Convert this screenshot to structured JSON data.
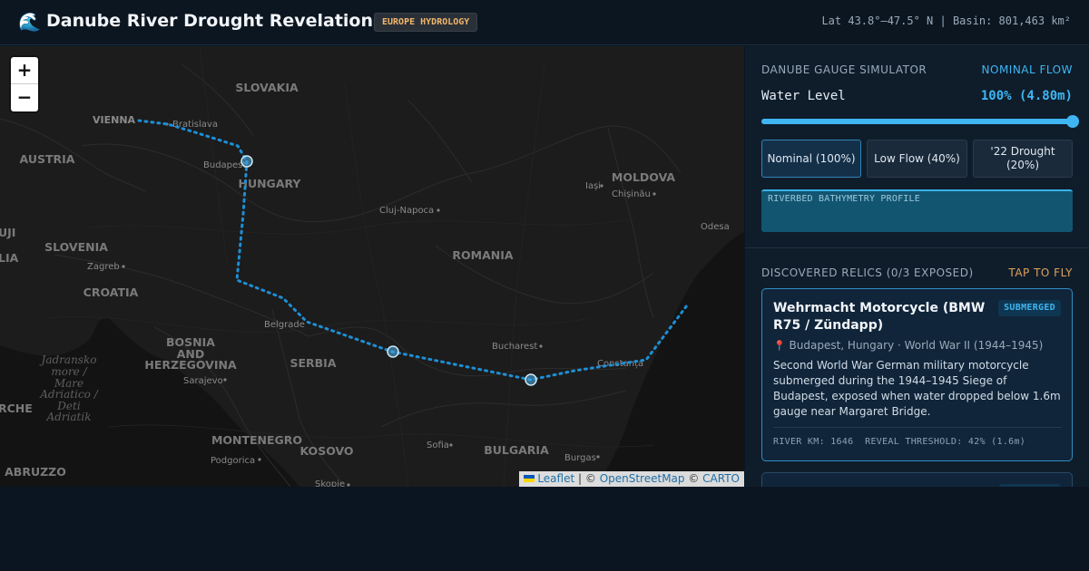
{
  "header": {
    "logo_icon": "🌊",
    "title": "Danube River Drought Revelations",
    "badge": "EUROPE HYDROLOGY",
    "coords": "Lat 43.8°–47.5° N | Basin: 801,463 km²"
  },
  "map": {
    "zoom_in": "+",
    "zoom_out": "−",
    "attribution": {
      "leaflet": "Leaflet",
      "sep1": " | © ",
      "osm": "OpenStreetMap",
      "sep2": " © ",
      "carto": "CARTO"
    },
    "countries": [
      "SLOVAKIA",
      "AUSTRIA",
      "HUNGARY",
      "SLOVENIA",
      "CROATIA",
      "ROMANIA",
      "MOLDOVA",
      "BOSNIA",
      "AND",
      "HERZEGOVINA",
      "SERBIA",
      "MONTENEGRO",
      "KOSOVO",
      "BULGARIA",
      "ABRUZZO",
      "UJI",
      "LIA",
      "RCHE"
    ],
    "cities": [
      "VIENNA",
      "Bratislava",
      "Budapest",
      "Cluj-Napoca",
      "Iași",
      "Chișinău",
      "Odesa",
      "Zagreb",
      "Belgrade",
      "Bucharest",
      "Constanța",
      "Sarajevo",
      "Podgorica",
      "Sofia",
      "Burgas",
      "Skopje"
    ],
    "sea_label": [
      "Jadransko",
      "more /",
      "Mare",
      "Adriatico /",
      "Deti",
      "Adriatik"
    ],
    "line_color": "#1d8fd6",
    "marker_color": "#4aa6dc"
  },
  "simulator": {
    "title": "DANUBE GAUGE SIMULATOR",
    "status": "NOMINAL FLOW",
    "status_color": "#3fb6f2",
    "water_level_label": "Water Level",
    "water_level_value": "100% (4.80m)",
    "water_level_fraction": 1.0,
    "buttons": [
      "Nominal (100%)",
      "Low Flow (40%)",
      "'22 Drought (20%)"
    ],
    "selected_button": 0,
    "bathymetry_label": "RIVERBED BATHYMETRY PROFILE"
  },
  "relics": {
    "title": "DISCOVERED RELICS (0/3 EXPOSED)",
    "action": "TAP TO FLY",
    "action_color": "#e0a15a",
    "card": {
      "title": "Wehrmacht Motorcycle (BMW R75 / Zündapp)",
      "badge": "SUBMERGED",
      "pin_icon": "📍",
      "location": "Budapest, Hungary · World War II (1944–1945)",
      "description": "Second World War German military motorcycle submerged during the 1944–1945 Siege of Budapest, exposed when water dropped below 1.6m gauge near Margaret Bridge.",
      "meta": "RIVER KM: 1646  REVEAL THRESHOLD: 42% (1.6m)"
    }
  }
}
